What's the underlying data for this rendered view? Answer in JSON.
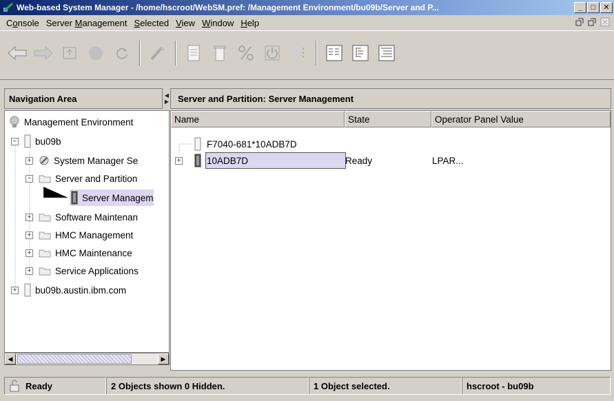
{
  "window": {
    "title": "Web-based System Manager - /home/hscroot/WebSM.pref: /Management Environment/bu09b/Server and P...",
    "minimize": "_",
    "maximize": "□",
    "close": "✕"
  },
  "menu": {
    "items": [
      "Console",
      "Server Management",
      "Selected",
      "View",
      "Window",
      "Help"
    ],
    "mnemonics": [
      "o",
      "M",
      "S",
      "V",
      "W",
      "H"
    ]
  },
  "toolbar": {
    "icons": [
      "back-arrow-icon",
      "forward-arrow-icon",
      "up-level-icon",
      "stop-icon",
      "refresh-icon",
      "find-icon",
      "properties-icon",
      "delete-icon",
      "percent-icon",
      "power-icon",
      "run-icon",
      "large-icons-icon",
      "tree-view-icon",
      "details-view-icon"
    ]
  },
  "navigation": {
    "header": "Navigation Area",
    "tree": [
      {
        "label": "Management Environment",
        "level": 0,
        "expander": ""
      },
      {
        "label": "bu09b",
        "level": 1,
        "expander": "−"
      },
      {
        "label": "System Manager Se",
        "level": 2,
        "expander": "+"
      },
      {
        "label": "Server and Partition",
        "level": 2,
        "expander": "−"
      },
      {
        "label": "Server Managem",
        "level": 3,
        "expander": ""
      },
      {
        "label": "Software Maintenan",
        "level": 2,
        "expander": "+"
      },
      {
        "label": "HMC Management",
        "level": 2,
        "expander": "+"
      },
      {
        "label": "HMC Maintenance",
        "level": 2,
        "expander": "+"
      },
      {
        "label": "Service Applications",
        "level": 2,
        "expander": "+"
      },
      {
        "label": "bu09b.austin.ibm.com",
        "level": 1,
        "expander": "+"
      }
    ]
  },
  "content": {
    "header": "Server and Partition: Server Management",
    "columns": [
      "Name",
      "State",
      "Operator Panel Value"
    ],
    "rows": [
      {
        "name": "F7040-681*10ADB7D",
        "state": "",
        "panel": "",
        "expander": ""
      },
      {
        "name": "10ADB7D",
        "state": "Ready",
        "panel": "LPAR...",
        "expander": "+"
      }
    ]
  },
  "status": {
    "ready": "Ready",
    "objects_shown": "2 Objects shown 0 Hidden.",
    "selected": "1 Object selected.",
    "user": "hscroot - bu09b"
  },
  "colors": {
    "title_start": "#0a246a",
    "title_end": "#a6caf0",
    "selection": "#dcd6f0",
    "chrome": "#d4d0c8"
  }
}
